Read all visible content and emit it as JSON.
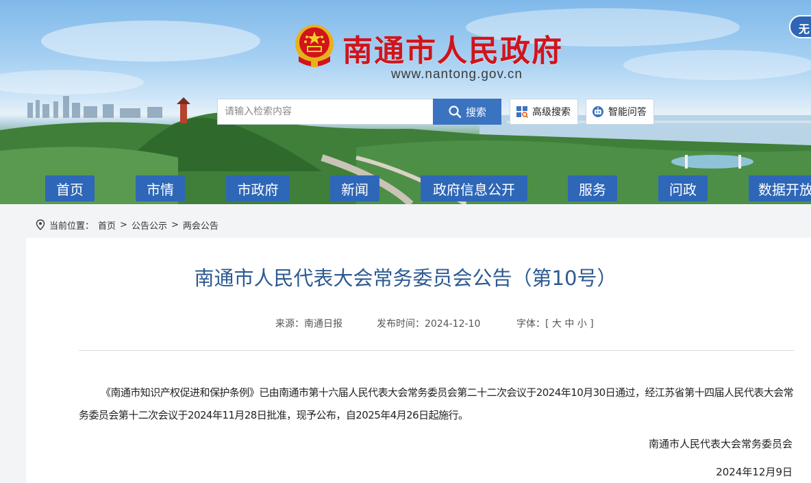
{
  "header": {
    "site_title": "南通市人民政府",
    "site_url": "www.nantong.gov.cn",
    "accessibility_label": "无"
  },
  "search": {
    "placeholder": "请输入检索内容",
    "button_label": "搜索",
    "advanced_label": "高级搜索",
    "smart_qa_label": "智能问答"
  },
  "nav": {
    "items": [
      "首页",
      "市情",
      "市政府",
      "新闻",
      "政府信息公开",
      "服务",
      "问政",
      "数据开放"
    ]
  },
  "breadcrumb": {
    "prefix": "当前位置：",
    "items": [
      "首页",
      "公告公示",
      "两会公告"
    ],
    "separator": ">"
  },
  "article": {
    "title": "南通市人民代表大会常务委员会公告（第10号）",
    "source": "来源：南通日报",
    "publish_time": "发布时间：2024-12-10",
    "font_size_label": "字体：[ 大 中 小 ]",
    "paragraph": "《南通市知识产权促进和保护条例》已由南通市第十六届人民代表大会常务委员会第二十二次会议于2024年10月30日通过，经江苏省第十四届人民代表大会常务委员会第十二次会议于2024年11月28日批准，现予公布，自2025年4月26日起施行。",
    "signature": "南通市人民代表大会常务委员会",
    "date": "2024年12月9日"
  },
  "colors": {
    "title_red": "#d0141c",
    "nav_blue": "#2e67b8",
    "article_title_blue": "#2c5a91"
  },
  "icons": [
    "national-emblem-icon",
    "search-icon",
    "advanced-search-icon",
    "robot-icon",
    "location-pin-icon"
  ]
}
